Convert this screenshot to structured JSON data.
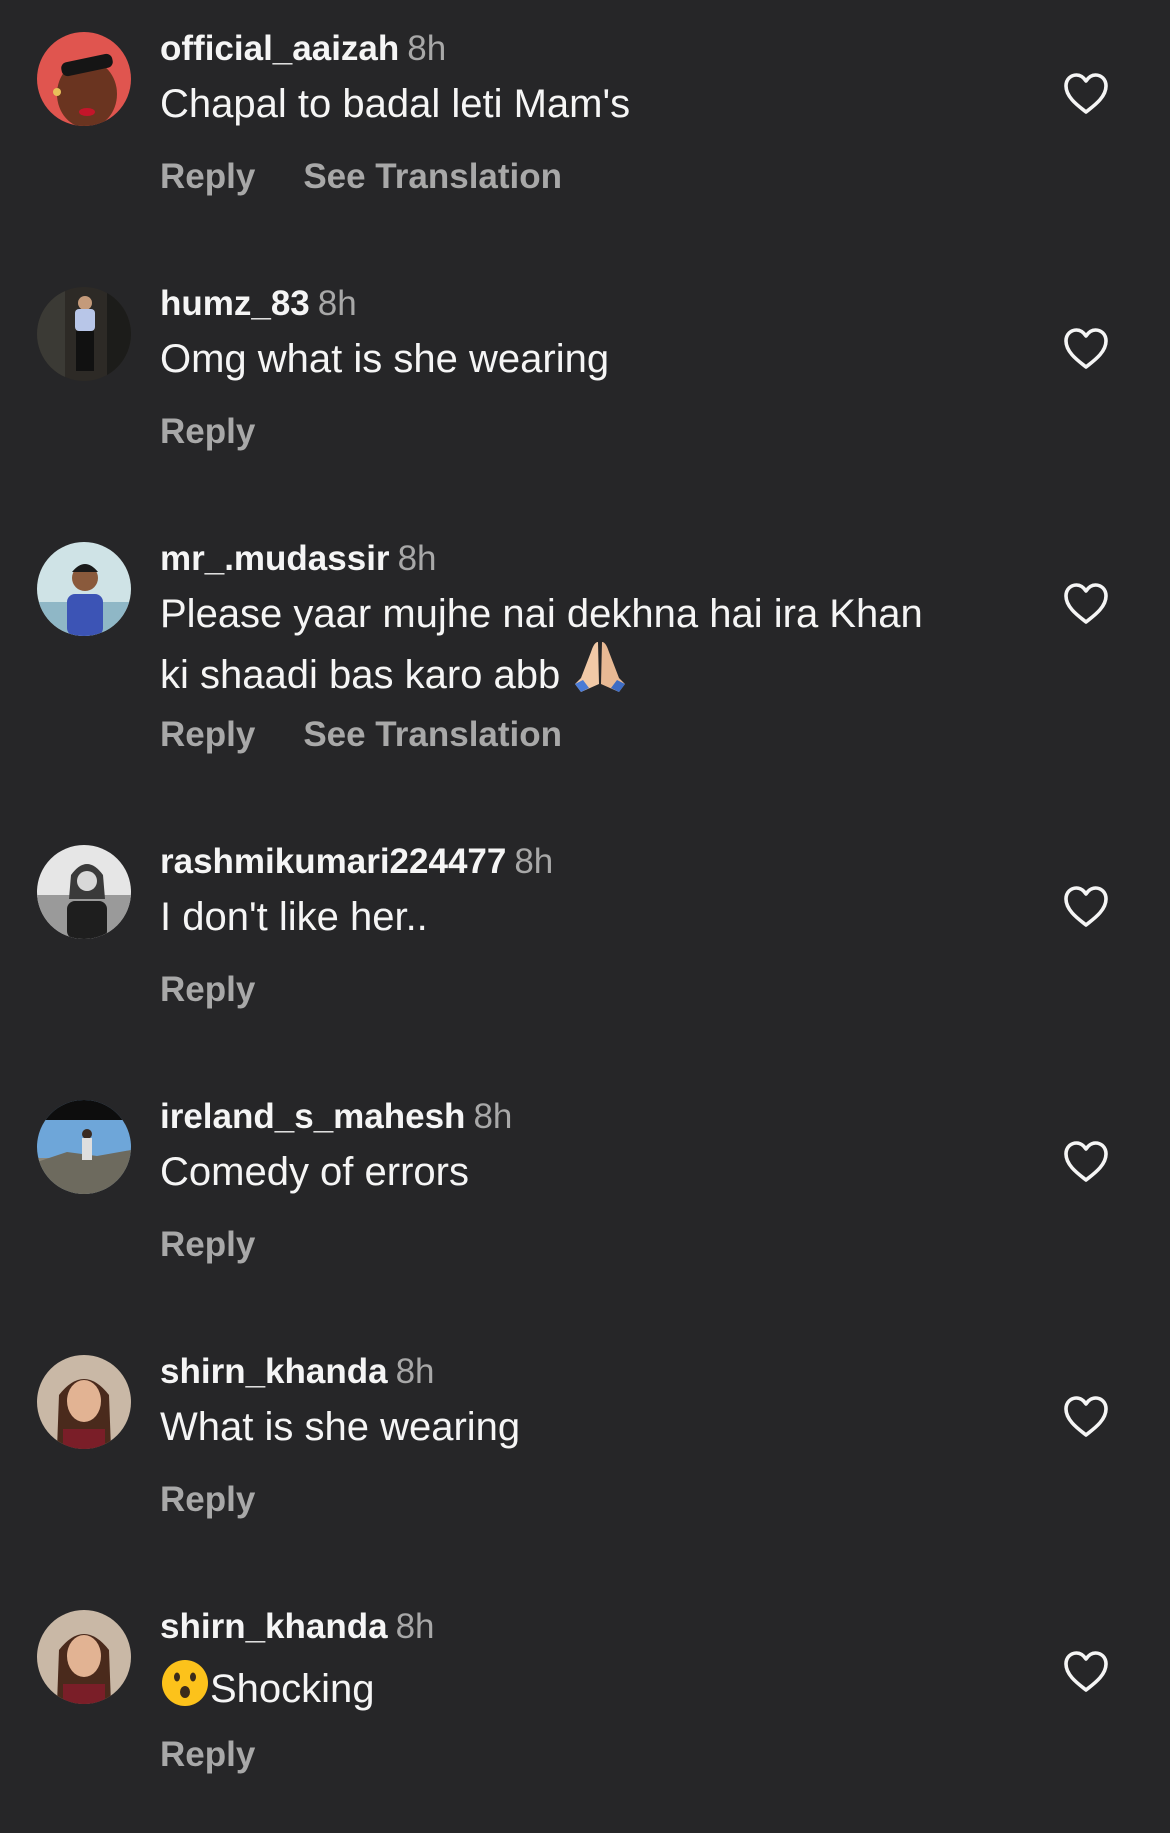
{
  "comments": [
    {
      "username": "official_aaizah",
      "time": "8h",
      "text": "Chapal to badal leti Mam's",
      "reply": "Reply",
      "translate": "See Translation"
    },
    {
      "username": "humz_83",
      "time": "8h",
      "text": "Omg what is she wearing",
      "reply": "Reply"
    },
    {
      "username": "mr_.mudassir",
      "time": "8h",
      "text_line1": "Please yaar mujhe nai dekhna hai ira Khan",
      "text_line2": "ki shaadi bas karo abb",
      "emoji": "folded-hands-emoji",
      "reply": "Reply",
      "translate": "See Translation"
    },
    {
      "username": "rashmikumari224477",
      "time": "8h",
      "text": "I don't like her..",
      "reply": "Reply"
    },
    {
      "username": "ireland_s_mahesh",
      "time": "8h",
      "text": "Comedy of errors",
      "reply": "Reply"
    },
    {
      "username": "shirn_khanda",
      "time": "8h",
      "text": "What is she wearing",
      "reply": "Reply"
    },
    {
      "username": "shirn_khanda",
      "time": "8h",
      "text": "Shocking",
      "emoji": "hushed-face-emoji",
      "reply": "Reply"
    }
  ],
  "colors": {
    "background": "#262628",
    "primary_text": "#f5f5f5",
    "secondary_text": "#a8a8a8"
  },
  "icons": {
    "like": "heart-outline-icon"
  }
}
